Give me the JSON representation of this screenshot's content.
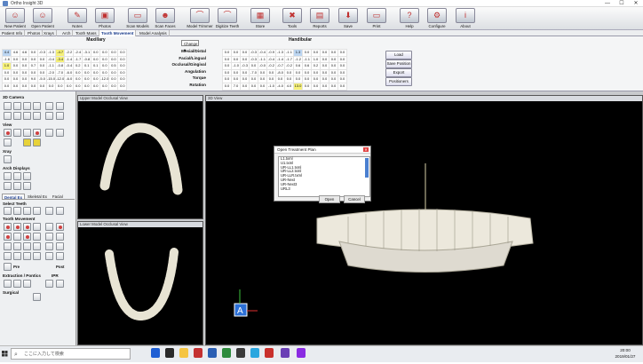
{
  "window": {
    "title": "Ortho Insight 3D",
    "controls": [
      "—",
      "☐",
      "✕"
    ]
  },
  "toolbar": {
    "buttons": [
      {
        "label": "New Patient",
        "glyph": "☺"
      },
      {
        "label": "Open Patient",
        "glyph": "☺"
      },
      {
        "label": "Notes",
        "glyph": "✎"
      },
      {
        "label": "Photos",
        "glyph": "▣"
      },
      {
        "label": "Scan Models",
        "glyph": "▭"
      },
      {
        "label": "Scan Faces",
        "glyph": "☻"
      },
      {
        "label": "Model Trimmer",
        "glyph": "⌒"
      },
      {
        "label": "Digitize Teeth",
        "glyph": "⌒"
      },
      {
        "label": "Store",
        "glyph": "▦"
      },
      {
        "label": "Tools",
        "glyph": "✖"
      },
      {
        "label": "Reports",
        "glyph": "▤"
      },
      {
        "label": "Save",
        "glyph": "⬇"
      },
      {
        "label": "Print",
        "glyph": "▭"
      },
      {
        "label": "Help",
        "glyph": "?"
      },
      {
        "label": "Configure",
        "glyph": "⚙"
      },
      {
        "label": "About",
        "glyph": "i"
      }
    ]
  },
  "tabs": [
    "Patient Info",
    "Photos",
    "Xrays",
    "Arch",
    "Tooth Mass",
    "Tooth Movement",
    "Model Analysis"
  ],
  "active_tab": "Tooth Movement",
  "maxillary": {
    "title": "Maxillary",
    "rows": [
      [
        "4.4",
        "4.6",
        "4.6",
        "0.0",
        "-0.3",
        "-1.3",
        "-4.7",
        "-2.2",
        "-2.4",
        "-3.1",
        "0.0",
        "0.0",
        "0.0",
        "0.0"
      ],
      [
        "-1.6",
        "0.0",
        "0.0",
        "0.0",
        "0.0",
        "-0.4",
        "-3.4",
        "-1.4",
        "-1.7",
        "-0.8",
        "0.0",
        "0.0",
        "0.0",
        "0.0"
      ],
      [
        "1.0",
        "0.0",
        "0.0",
        "0.7",
        "0.0",
        "-1.1",
        "-0.8",
        "-0.4",
        "0.2",
        "0.1",
        "0.1",
        "0.0",
        "0.5",
        "0.0"
      ],
      [
        "0.0",
        "0.0",
        "0.0",
        "0.0",
        "0.0",
        "-2.0",
        "-7.0",
        "-6.0",
        "0.0",
        "0.0",
        "0.0",
        "0.0",
        "0.0",
        "0.0"
      ],
      [
        "0.0",
        "0.0",
        "0.0",
        "9.0",
        "-5.0",
        "-15.0",
        "-12.0",
        "-6.0",
        "0.0",
        "0.0",
        "0.0",
        "-12.0",
        "0.0",
        "0.0"
      ],
      [
        "0.0",
        "0.0",
        "0.0",
        "0.0",
        "0.0",
        "0.0",
        "0.0",
        "0.0",
        "0.0",
        "0.0",
        "0.0",
        "0.0",
        "0.0",
        "0.0"
      ]
    ],
    "first_col": [
      "5",
      "4",
      "3",
      "2",
      "1",
      "0"
    ]
  },
  "change_dropdown": "Change",
  "mandibular": {
    "title": "Handibular",
    "rows": [
      [
        "0.0",
        "0.0",
        "0.0",
        "-0.3",
        "-0.4",
        "-0.9",
        "-1.3",
        "-1.1",
        "1.3",
        "0.0",
        "0.0",
        "0.0",
        "0.0",
        "0.0"
      ],
      [
        "0.0",
        "0.0",
        "0.0",
        "-0.3",
        "-1.1",
        "-0.4",
        "-1.4",
        "-1.7",
        "-1.2",
        "-1.1",
        "1.0",
        "0.0",
        "0.0",
        "0.0"
      ],
      [
        "0.0",
        "-1.0",
        "-0.3",
        "0.0",
        "-0.0",
        "-0.2",
        "-0.7",
        "-0.2",
        "0.6",
        "0.6",
        "0.2",
        "0.0",
        "0.0",
        "0.0"
      ],
      [
        "0.0",
        "0.0",
        "0.0",
        "-7.0",
        "0.0",
        "0.0",
        "-8.0",
        "0.0",
        "0.0",
        "0.0",
        "0.0",
        "0.0",
        "0.0",
        "0.0"
      ],
      [
        "0.0",
        "0.0",
        "0.0",
        "0.0",
        "0.0",
        "0.0",
        "0.0",
        "0.0",
        "0.0",
        "0.0",
        "0.0",
        "0.0",
        "0.0",
        "0.0"
      ],
      [
        "0.0",
        "7.0",
        "0.0",
        "0.0",
        "0.0",
        "-1.0",
        "-4.0",
        "4.0",
        "13.0",
        "0.0",
        "0.0",
        "0.0",
        "0.0",
        "0.0"
      ]
    ]
  },
  "row_labels": [
    "Mesial/Distal",
    "Facial/Lingual",
    "Occlusal/Gingival",
    "Angulation",
    "Torque",
    "Rotation"
  ],
  "side_buttons": [
    "Load",
    "Save Position",
    "Export",
    "Positioners"
  ],
  "left_panel": {
    "camera": "3D Camera",
    "view": "View",
    "xray": "Xray",
    "arch_displays": "Arch Displays",
    "subtabs": [
      "Dental Ex",
      "Skeletal Ex",
      "Facial"
    ],
    "select_teeth": "Select Teeth",
    "tooth_movement": "Tooth Movement",
    "pre": "Pre",
    "post": "Post",
    "extraction": "Extraction / Pontics",
    "ipr": "IPR",
    "surgical": "Surgical"
  },
  "views": {
    "upper": "Upper Model Occlusal View",
    "lower": "Lower Model Occlusal View",
    "three_d": "3D View"
  },
  "dialog": {
    "title": "Open Treatment Plan",
    "items": [
      "L1.txml",
      "U1.txml",
      "UR-LL1.txml",
      "UR-LL2.txml",
      "UR-LLR.txml",
      "UR-Next",
      "UR-Next3",
      "URL3"
    ],
    "open": "Open",
    "cancel": "Cancel"
  },
  "taskbar": {
    "search_placeholder": "ここに入力して検索",
    "time": "20:00",
    "date": "2019/01/27"
  }
}
